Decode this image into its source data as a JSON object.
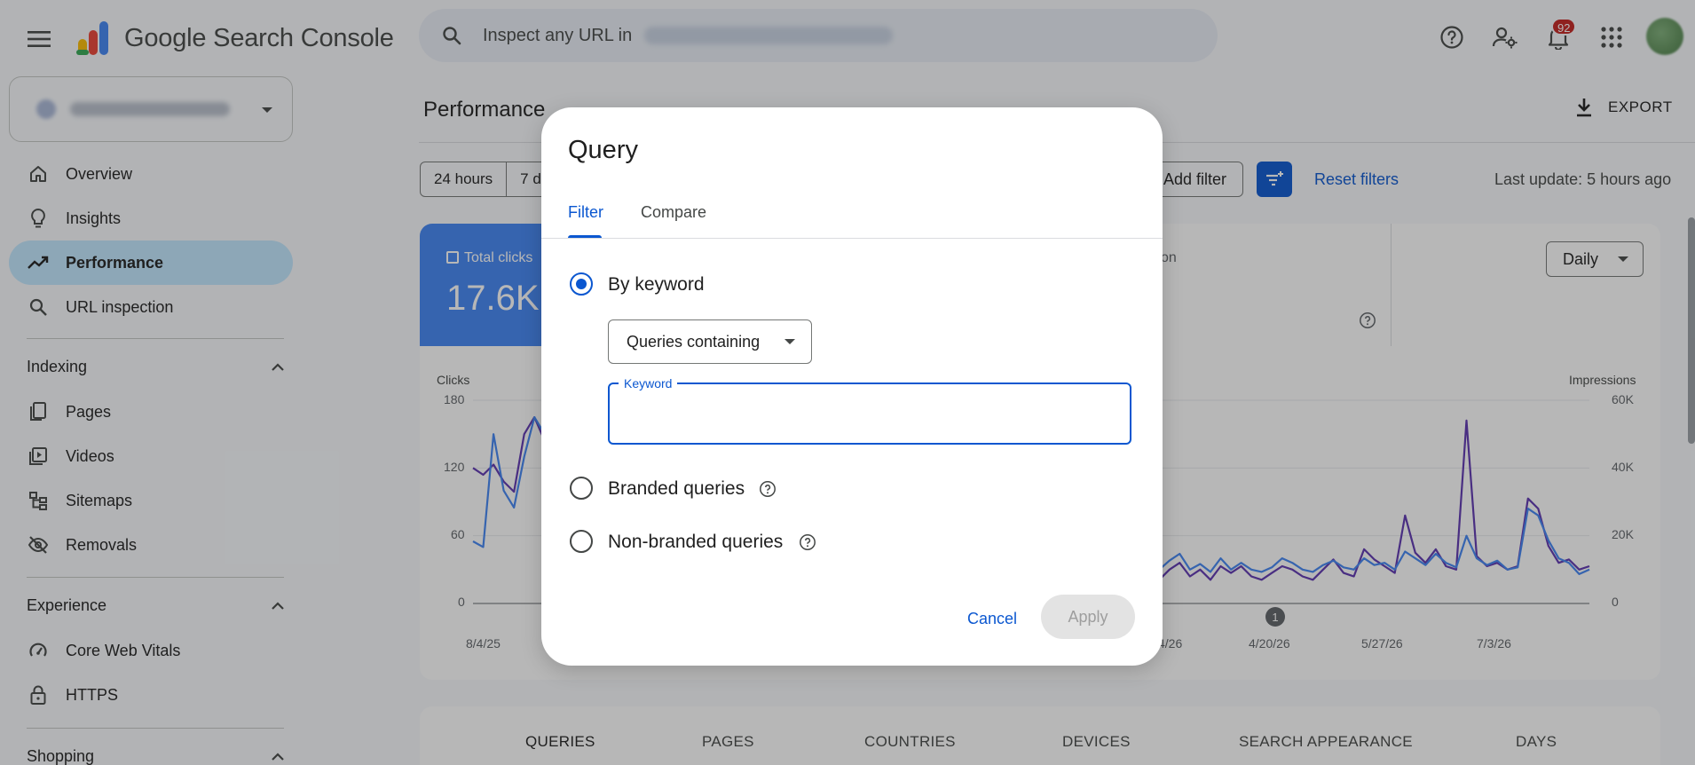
{
  "header": {
    "product_name": "Google Search Console",
    "search_placeholder": "Inspect any URL in",
    "notification_count": "92"
  },
  "sidebar": {
    "items": [
      {
        "label": "Overview",
        "icon": "home-icon"
      },
      {
        "label": "Insights",
        "icon": "lightbulb-icon"
      },
      {
        "label": "Performance",
        "icon": "trending-up-icon",
        "active": true
      },
      {
        "label": "URL inspection",
        "icon": "search-icon"
      }
    ],
    "sections": [
      {
        "title": "Indexing",
        "items": [
          {
            "label": "Pages",
            "icon": "pages-icon"
          },
          {
            "label": "Videos",
            "icon": "video-icon"
          },
          {
            "label": "Sitemaps",
            "icon": "sitemap-icon"
          },
          {
            "label": "Removals",
            "icon": "eye-off-icon"
          }
        ]
      },
      {
        "title": "Experience",
        "items": [
          {
            "label": "Core Web Vitals",
            "icon": "gauge-icon"
          },
          {
            "label": "HTTPS",
            "icon": "lock-icon"
          }
        ]
      },
      {
        "title": "Shopping",
        "items": []
      }
    ]
  },
  "main": {
    "title": "Performance",
    "export_label": "EXPORT",
    "date_chips": [
      "24 hours",
      "7 d"
    ],
    "add_filter_label": "Add filter",
    "reset_filters_label": "Reset filters",
    "last_update": "Last update: 5 hours ago",
    "metric_clicks": {
      "label": "Total clicks",
      "value": "17.6K"
    },
    "metric_partial_label": "on",
    "granularity": "Daily",
    "table_tabs": [
      "QUERIES",
      "PAGES",
      "COUNTRIES",
      "DEVICES",
      "SEARCH APPEARANCE",
      "DAYS"
    ]
  },
  "chart_data": {
    "type": "line",
    "left_axis_title": "Clicks",
    "right_axis_title": "Impressions",
    "left_ticks": [
      "180",
      "120",
      "60",
      "0"
    ],
    "right_ticks": [
      "60K",
      "40K",
      "20K",
      "0"
    ],
    "x_ticks": [
      "8/4/25",
      "4/26",
      "4/20/26",
      "5/27/26",
      "7/3/26"
    ],
    "annotation": "1",
    "ylim_left": [
      0,
      180
    ],
    "ylim_right": [
      0,
      60000
    ],
    "series": [
      {
        "name": "Clicks",
        "color": "#4285f4",
        "values": [
          55,
          50,
          150,
          100,
          85,
          130,
          165,
          150,
          110,
          90,
          120,
          80,
          100,
          95,
          105,
          85,
          90,
          100,
          110,
          90,
          95,
          75,
          100,
          90,
          105,
          90,
          80,
          95,
          100,
          90,
          40,
          50,
          45,
          35,
          50,
          40,
          45,
          55,
          40,
          38,
          45,
          50,
          40,
          35,
          45,
          50,
          42,
          38,
          55,
          45,
          48,
          40,
          50,
          46,
          42,
          44,
          48,
          40,
          36,
          45,
          42,
          38,
          50,
          40,
          30,
          42,
          36,
          30,
          38,
          44,
          30,
          35,
          28,
          40,
          30,
          36,
          30,
          28,
          32,
          40,
          36,
          30,
          28,
          34,
          38,
          32,
          30,
          40,
          34,
          36,
          30,
          46,
          40,
          34,
          44,
          36,
          32,
          60,
          40,
          34,
          38,
          30,
          32,
          84,
          78,
          56,
          40,
          36,
          26,
          30
        ]
      },
      {
        "name": "Impressions",
        "color": "#5e35b1",
        "values": [
          40000,
          38000,
          41000,
          36000,
          33000,
          50000,
          55000,
          48000,
          40000,
          35000,
          30000,
          38000,
          33000,
          30000,
          35000,
          28000,
          33000,
          30000,
          35000,
          30000,
          32000,
          28000,
          30000,
          28000,
          30000,
          28000,
          26000,
          28000,
          30000,
          28000,
          16000,
          14000,
          15000,
          12000,
          26000,
          12000,
          15000,
          14000,
          13000,
          12000,
          14000,
          15000,
          12000,
          11000,
          14000,
          12000,
          13000,
          11000,
          27000,
          12000,
          14000,
          12000,
          13000,
          11000,
          11000,
          12000,
          13000,
          11000,
          10000,
          12000,
          9000,
          11000,
          14000,
          12000,
          7000,
          9000,
          8000,
          7000,
          10000,
          12000,
          8000,
          10000,
          7000,
          11000,
          9000,
          11000,
          8000,
          7000,
          9000,
          11000,
          10000,
          8000,
          7000,
          10000,
          13000,
          9000,
          8000,
          16000,
          13000,
          11000,
          9000,
          26000,
          15000,
          12000,
          16000,
          11000,
          10000,
          54000,
          14000,
          11000,
          12000,
          10000,
          11000,
          31000,
          28000,
          17000,
          12000,
          13000,
          10000,
          11000
        ]
      }
    ]
  },
  "dialog": {
    "title": "Query",
    "tabs": [
      "Filter",
      "Compare"
    ],
    "option_by_keyword": "By keyword",
    "match_select": "Queries containing",
    "keyword_label": "Keyword",
    "keyword_value": "",
    "option_branded": "Branded queries",
    "option_non_branded": "Non-branded queries",
    "cancel_label": "Cancel",
    "apply_label": "Apply"
  }
}
